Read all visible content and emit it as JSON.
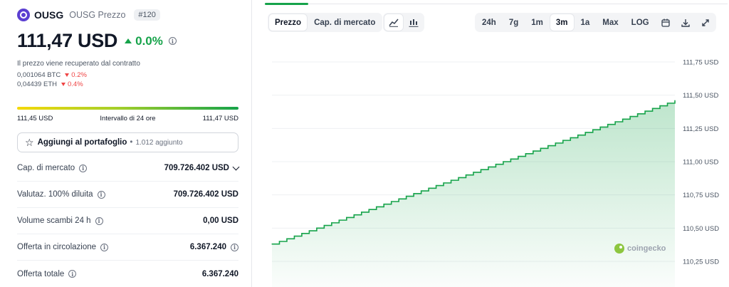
{
  "coin": {
    "symbol": "OUSG",
    "name": "OUSG Prezzo",
    "rank": "#120",
    "price": "111,47 USD",
    "change": "0.0%",
    "contract_note": "Il prezzo viene recuperato dal contratto",
    "conversions": [
      {
        "value": "0,001064 BTC",
        "change": "0.2%"
      },
      {
        "value": "0,04439 ETH",
        "change": "0.4%"
      }
    ]
  },
  "range": {
    "low": "111,45 USD",
    "label": "Intervallo di 24 ore",
    "high": "111,47 USD"
  },
  "portfolio": {
    "label": "Aggiungi al portafoglio",
    "count": "1.012 aggiunto"
  },
  "stats": [
    {
      "label": "Cap. di mercato",
      "value": "709.726.402 USD",
      "extra": "chevron-down-icon"
    },
    {
      "label": "Valutaz. 100% diluita",
      "value": "709.726.402 USD",
      "extra": "none"
    },
    {
      "label": "Volume scambi 24 h",
      "value": "0,00 USD",
      "extra": "none"
    },
    {
      "label": "Offerta in circolazione",
      "value": "6.367.240",
      "extra": "info-icon"
    },
    {
      "label": "Offerta totale",
      "value": "6.367.240",
      "extra": "none"
    }
  ],
  "toolbar": {
    "metric_tabs": [
      "Prezzo",
      "Cap. di mercato"
    ],
    "active_metric": "Prezzo",
    "chart_type_icons": [
      "line-chart-icon",
      "candlestick-icon"
    ],
    "ranges": [
      "24h",
      "7g",
      "1m",
      "3m",
      "1a",
      "Max",
      "LOG"
    ],
    "active_range": "3m",
    "action_icons": [
      "calendar-icon",
      "download-icon",
      "expand-icon"
    ]
  },
  "chart_data": {
    "type": "area",
    "y_ticks": [
      "111,75 USD",
      "111,50 USD",
      "111,25 USD",
      "111,00 USD",
      "110,75 USD",
      "110,50 USD",
      "110,25 USD"
    ],
    "ylim": [
      110.25,
      111.75
    ],
    "grid": true,
    "line_color": "#16a34a",
    "fill_color": "#16a34a",
    "watermark": "coingecko",
    "series": [
      {
        "values": [
          110.38,
          110.4,
          110.42,
          110.44,
          110.46,
          110.48,
          110.5,
          110.52,
          110.54,
          110.56,
          110.58,
          110.6,
          110.62,
          110.64,
          110.66,
          110.68,
          110.7,
          110.72,
          110.74,
          110.76,
          110.78,
          110.8,
          110.82,
          110.84,
          110.86,
          110.88,
          110.9,
          110.92,
          110.94,
          110.96,
          110.98,
          111.0,
          111.02,
          111.04,
          111.06,
          111.08,
          111.1,
          111.12,
          111.14,
          111.16,
          111.18,
          111.2,
          111.22,
          111.24,
          111.26,
          111.28,
          111.3,
          111.32,
          111.34,
          111.36,
          111.38,
          111.4,
          111.42,
          111.44,
          111.46
        ]
      }
    ]
  }
}
